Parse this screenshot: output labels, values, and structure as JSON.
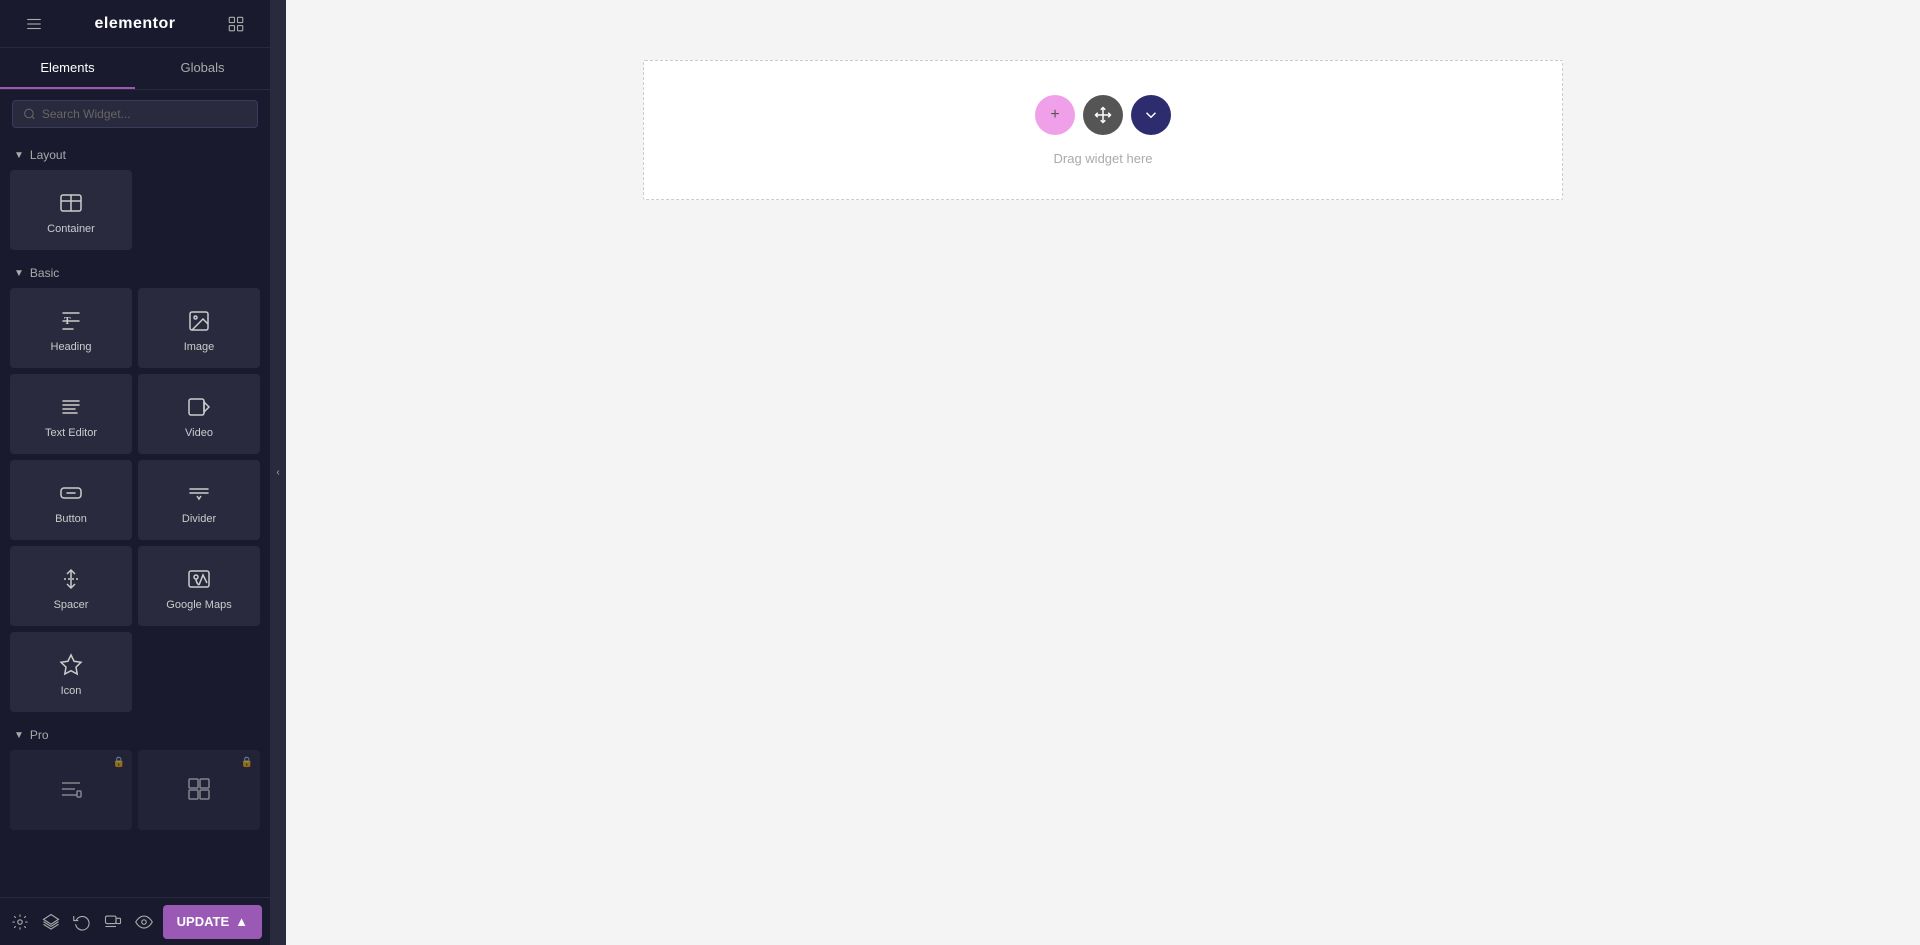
{
  "header": {
    "logo": "elementor",
    "hamburger_icon": "hamburger-icon",
    "grid_icon": "grid-icon"
  },
  "tabs": {
    "elements_label": "Elements",
    "globals_label": "Globals",
    "active": "elements"
  },
  "search": {
    "placeholder": "Search Widget..."
  },
  "layout_section": {
    "label": "Layout",
    "widgets": [
      {
        "id": "container",
        "label": "Container",
        "locked": false
      }
    ]
  },
  "basic_section": {
    "label": "Basic",
    "widgets": [
      {
        "id": "heading",
        "label": "Heading",
        "locked": false
      },
      {
        "id": "image",
        "label": "Image",
        "locked": false
      },
      {
        "id": "text-editor",
        "label": "Text Editor",
        "locked": false
      },
      {
        "id": "video",
        "label": "Video",
        "locked": false
      },
      {
        "id": "button",
        "label": "Button",
        "locked": false
      },
      {
        "id": "divider",
        "label": "Divider",
        "locked": false
      },
      {
        "id": "spacer",
        "label": "Spacer",
        "locked": false
      },
      {
        "id": "google-maps",
        "label": "Google Maps",
        "locked": false
      },
      {
        "id": "icon",
        "label": "Icon",
        "locked": false
      }
    ]
  },
  "pro_section": {
    "label": "Pro",
    "widgets": [
      {
        "id": "price-list",
        "label": "",
        "locked": true
      },
      {
        "id": "price-table",
        "label": "",
        "locked": true
      }
    ]
  },
  "bottom_bar": {
    "settings_icon": "settings-icon",
    "layers_icon": "layers-icon",
    "history_icon": "history-icon",
    "responsive_icon": "responsive-icon",
    "preview_icon": "preview-icon",
    "update_label": "UPDATE",
    "update_arrow": "▲"
  },
  "canvas": {
    "drag_hint": "Drag widget here"
  },
  "colors": {
    "accent": "#9b59b6",
    "sidebar_bg": "#1a1a2e",
    "widget_bg": "#2a2a3e",
    "ctrl_pink": "#f0a0e8",
    "ctrl_dark": "#555555",
    "ctrl_navy": "#2c2c6e"
  }
}
